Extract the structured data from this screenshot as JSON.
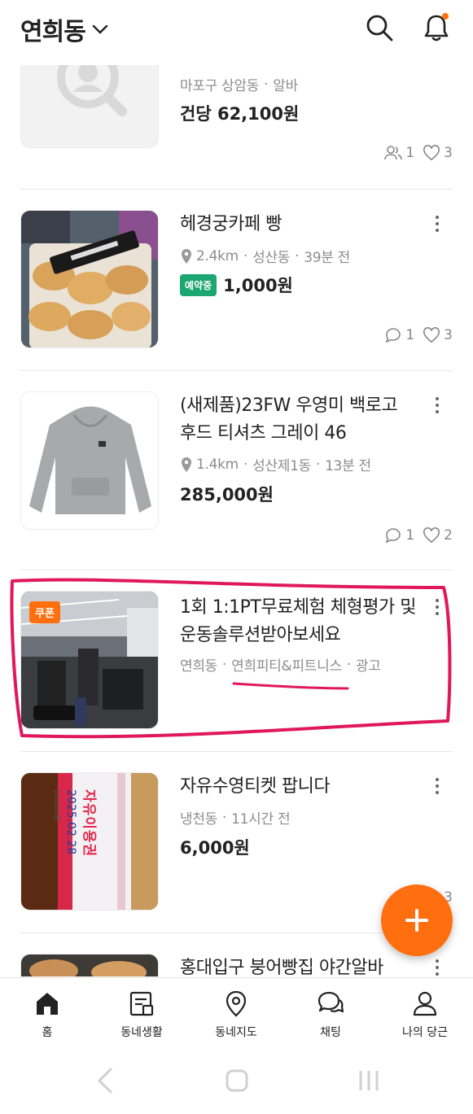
{
  "header": {
    "location": "연희동",
    "search_icon": "search-icon",
    "bell_icon": "bell-icon"
  },
  "items": [
    {
      "title": "",
      "location": "마포구 상암동",
      "time": "알바",
      "price": "건당 62,100원",
      "applicants": "1",
      "likes": "3"
    },
    {
      "title": "헤경궁카페 빵",
      "distance": "2.4km",
      "location": "성산동",
      "time": "39분 전",
      "badge": "예약중",
      "price": "1,000원",
      "chats": "1",
      "likes": "3"
    },
    {
      "title": "(새제품)23FW 우영미 백로고 후드 티셔츠 그레이 46",
      "distance": "1.4km",
      "location": "성산제1동",
      "time": "13분 전",
      "price": "285,000원",
      "chats": "1",
      "likes": "2"
    },
    {
      "title": "1회 1:1PT무료체험 체형평가 및 운동솔루션받아보세요",
      "location": "연희동",
      "advertiser": "연희피티&피트니스",
      "ad_label": "광고",
      "coupon": "쿠폰"
    },
    {
      "title": "자유수영티켓 팝니다",
      "location": "냉천동",
      "time": "11시간 전",
      "price": "6,000원",
      "likes": "3",
      "ticket_title": "자유이용권",
      "ticket_date": "2025.02.28",
      "ticket_price": "10,000원"
    },
    {
      "title": "홍대입구 붕어빵집 야간알바"
    }
  ],
  "tabs": [
    {
      "label": "홈",
      "icon": "home-icon"
    },
    {
      "label": "동네생활",
      "icon": "community-icon"
    },
    {
      "label": "동네지도",
      "icon": "map-pin-icon"
    },
    {
      "label": "채팅",
      "icon": "chat-icon"
    },
    {
      "label": "나의 당근",
      "icon": "profile-icon"
    }
  ],
  "colors": {
    "accent": "#ff6f0f",
    "badge": "#1ba672",
    "highlight": "#e0185b"
  }
}
